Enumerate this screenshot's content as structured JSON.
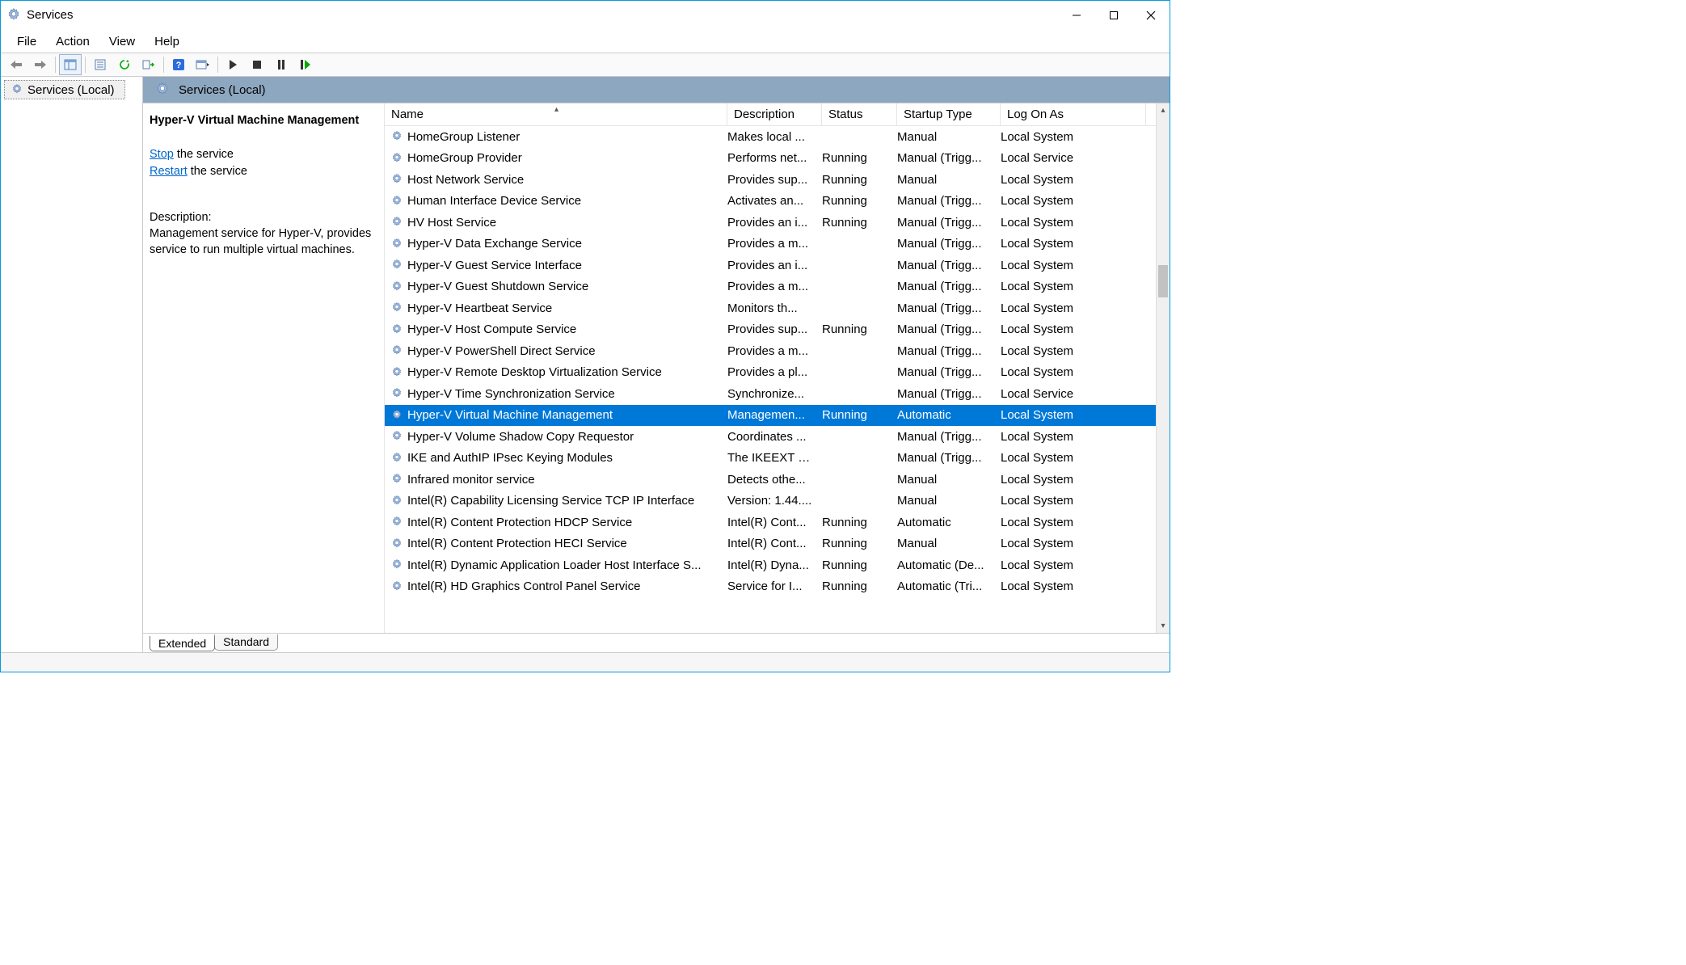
{
  "window_title": "Services",
  "menu": {
    "file": "File",
    "action": "Action",
    "view": "View",
    "help": "Help"
  },
  "tree": {
    "root_label": "Services (Local)"
  },
  "content_header": "Services (Local)",
  "details": {
    "title": "Hyper-V Virtual Machine Management",
    "stop_link": "Stop",
    "stop_suffix": " the service",
    "restart_link": "Restart",
    "restart_suffix": " the service",
    "desc_label": "Description:",
    "desc_text": "Management service for Hyper-V, provides service to run multiple virtual machines."
  },
  "columns": {
    "name": "Name",
    "description": "Description",
    "status": "Status",
    "startup": "Startup Type",
    "logon": "Log On As"
  },
  "tabs": {
    "extended": "Extended",
    "standard": "Standard"
  },
  "selected_index": 13,
  "rows": [
    {
      "name": "HomeGroup Listener",
      "desc": "Makes local ...",
      "status": "",
      "startup": "Manual",
      "logon": "Local System"
    },
    {
      "name": "HomeGroup Provider",
      "desc": "Performs net...",
      "status": "Running",
      "startup": "Manual (Trigg...",
      "logon": "Local Service"
    },
    {
      "name": "Host Network Service",
      "desc": "Provides sup...",
      "status": "Running",
      "startup": "Manual",
      "logon": "Local System"
    },
    {
      "name": "Human Interface Device Service",
      "desc": "Activates an...",
      "status": "Running",
      "startup": "Manual (Trigg...",
      "logon": "Local System"
    },
    {
      "name": "HV Host Service",
      "desc": "Provides an i...",
      "status": "Running",
      "startup": "Manual (Trigg...",
      "logon": "Local System"
    },
    {
      "name": "Hyper-V Data Exchange Service",
      "desc": "Provides a m...",
      "status": "",
      "startup": "Manual (Trigg...",
      "logon": "Local System"
    },
    {
      "name": "Hyper-V Guest Service Interface",
      "desc": "Provides an i...",
      "status": "",
      "startup": "Manual (Trigg...",
      "logon": "Local System"
    },
    {
      "name": "Hyper-V Guest Shutdown Service",
      "desc": "Provides a m...",
      "status": "",
      "startup": "Manual (Trigg...",
      "logon": "Local System"
    },
    {
      "name": "Hyper-V Heartbeat Service",
      "desc": "Monitors th...",
      "status": "",
      "startup": "Manual (Trigg...",
      "logon": "Local System"
    },
    {
      "name": "Hyper-V Host Compute Service",
      "desc": "Provides sup...",
      "status": "Running",
      "startup": "Manual (Trigg...",
      "logon": "Local System"
    },
    {
      "name": "Hyper-V PowerShell Direct Service",
      "desc": "Provides a m...",
      "status": "",
      "startup": "Manual (Trigg...",
      "logon": "Local System"
    },
    {
      "name": "Hyper-V Remote Desktop Virtualization Service",
      "desc": "Provides a pl...",
      "status": "",
      "startup": "Manual (Trigg...",
      "logon": "Local System"
    },
    {
      "name": "Hyper-V Time Synchronization Service",
      "desc": "Synchronize...",
      "status": "",
      "startup": "Manual (Trigg...",
      "logon": "Local Service"
    },
    {
      "name": "Hyper-V Virtual Machine Management",
      "desc": "Managemen...",
      "status": "Running",
      "startup": "Automatic",
      "logon": "Local System"
    },
    {
      "name": "Hyper-V Volume Shadow Copy Requestor",
      "desc": "Coordinates ...",
      "status": "",
      "startup": "Manual (Trigg...",
      "logon": "Local System"
    },
    {
      "name": "IKE and AuthIP IPsec Keying Modules",
      "desc": "The IKEEXT s...",
      "status": "",
      "startup": "Manual (Trigg...",
      "logon": "Local System"
    },
    {
      "name": "Infrared monitor service",
      "desc": "Detects othe...",
      "status": "",
      "startup": "Manual",
      "logon": "Local System"
    },
    {
      "name": "Intel(R) Capability Licensing Service TCP IP Interface",
      "desc": "Version: 1.44....",
      "status": "",
      "startup": "Manual",
      "logon": "Local System"
    },
    {
      "name": "Intel(R) Content Protection HDCP Service",
      "desc": "Intel(R) Cont...",
      "status": "Running",
      "startup": "Automatic",
      "logon": "Local System"
    },
    {
      "name": "Intel(R) Content Protection HECI Service",
      "desc": "Intel(R) Cont...",
      "status": "Running",
      "startup": "Manual",
      "logon": "Local System"
    },
    {
      "name": "Intel(R) Dynamic Application Loader Host Interface S...",
      "desc": "Intel(R) Dyna...",
      "status": "Running",
      "startup": "Automatic (De...",
      "logon": "Local System"
    },
    {
      "name": "Intel(R) HD Graphics Control Panel Service",
      "desc": "Service for I...",
      "status": "Running",
      "startup": "Automatic (Tri...",
      "logon": "Local System"
    }
  ]
}
